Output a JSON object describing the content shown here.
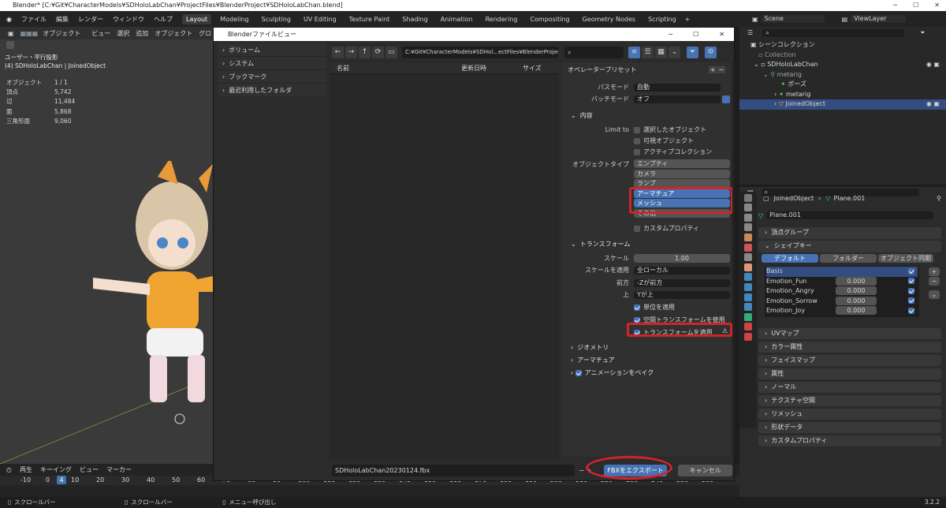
{
  "window": {
    "title": "Blender* [C:¥Git¥CharacterModels¥SDHoloLabChan¥ProjectFiles¥BlenderProject¥SDHoloLabChan.blend]"
  },
  "menu": [
    "ファイル",
    "編集",
    "レンダー",
    "ウィンドウ",
    "ヘルプ"
  ],
  "workspaces": [
    "Layout",
    "Modeling",
    "Sculpting",
    "UV Editing",
    "Texture Paint",
    "Shading",
    "Animation",
    "Rendering",
    "Compositing",
    "Geometry Nodes",
    "Scripting"
  ],
  "active_workspace": "Layout",
  "scene": {
    "label": "Scene",
    "view_layer": "ViewLayer"
  },
  "viewport": {
    "mode": "オブジェクト",
    "header_menus": [
      "ビュー",
      "選択",
      "追加",
      "オブジェクト"
    ],
    "gl_label": "グロ",
    "view_name": "ユーザー・平行投影",
    "object_name": "(4) SDHoloLabChan | JoinedObject",
    "stats": [
      {
        "label": "オブジェクト",
        "value": "1 / 1"
      },
      {
        "label": "頂点",
        "value": "5,742"
      },
      {
        "label": "辺",
        "value": "11,484"
      },
      {
        "label": "面",
        "value": "5,868"
      },
      {
        "label": "三角形面",
        "value": "9,060"
      }
    ]
  },
  "dialog": {
    "title": "Blenderファイルビュー",
    "sidebar": [
      "ボリューム",
      "システム",
      "ブックマーク",
      "最近利用したフォルダ"
    ],
    "path": "C:¥Git¥CharacterModels¥SDHol...ectFiles¥BlenderProject¥Export¥",
    "columns": {
      "name": "名前",
      "date": "更新日時",
      "size": "サイズ"
    },
    "operator_preset": "オペレータープリセット",
    "path_mode": {
      "label": "パスモード",
      "value": "自動"
    },
    "batch_mode": {
      "label": "バッチモード",
      "value": "オフ"
    },
    "include_section": "内容",
    "limit_to": {
      "label": "Limit to",
      "options": [
        {
          "label": "選択したオブジェクト",
          "checked": false
        },
        {
          "label": "可視オブジェクト",
          "checked": false
        },
        {
          "label": "アクティブコレクション",
          "checked": false
        }
      ]
    },
    "object_type": {
      "label": "オブジェクトタイプ",
      "options": [
        {
          "label": "エンプティ",
          "selected": false
        },
        {
          "label": "カメラ",
          "selected": false
        },
        {
          "label": "ランプ",
          "selected": false
        },
        {
          "label": "アーマチュア",
          "selected": true
        },
        {
          "label": "メッシュ",
          "selected": true
        },
        {
          "label": "その他",
          "selected": false
        }
      ]
    },
    "custom_props": {
      "label": "カスタムプロパティ",
      "checked": false
    },
    "transform_section": "トランスフォーム",
    "scale": {
      "label": "スケール",
      "value": "1.00"
    },
    "apply_scaling": {
      "label": "スケールを適用",
      "value": "全ローカル"
    },
    "forward": {
      "label": "前方",
      "value": "-Zが前方"
    },
    "up": {
      "label": "上",
      "value": "Yが上"
    },
    "apply_unit": {
      "label": "単位を適用",
      "checked": true
    },
    "space_transform": {
      "label": "空間トランスフォームを使用",
      "checked": true
    },
    "apply_transform": {
      "label": "トランスフォームを適用",
      "checked": true
    },
    "collapsed_sections": [
      "ジオメトリ",
      "アーマチュア"
    ],
    "bake_anim": {
      "label": "アニメーションをベイク",
      "checked": true
    },
    "filename": "SDHoloLabChan20230124.fbx",
    "export_label": "FBXをエクスポート",
    "cancel_label": "キャンセル"
  },
  "outliner": {
    "root": "シーンコレクション",
    "items": [
      {
        "label": "Collection",
        "level": 1
      },
      {
        "label": "SDHoloLabChan",
        "level": 1
      },
      {
        "label": "metarig",
        "level": 2
      },
      {
        "label": "ポーズ",
        "level": 3
      },
      {
        "label": "metarig",
        "level": 3
      },
      {
        "label": "JoinedObject",
        "level": 2
      }
    ]
  },
  "properties": {
    "breadcrumb_object": "JoinedObject",
    "breadcrumb_data": "Plane.001",
    "mesh_name": "Plane.001",
    "sections_top": [
      "頂点グループ",
      "シェイプキー"
    ],
    "shapekey_tabs": [
      "デフォルト",
      "フォルダー",
      "オブジェクト同期"
    ],
    "shapekeys": [
      {
        "name": "Basis",
        "value": ""
      },
      {
        "name": "Emotion_Fun",
        "value": "0.000"
      },
      {
        "name": "Emotion_Angry",
        "value": "0.000"
      },
      {
        "name": "Emotion_Sorrow",
        "value": "0.000"
      },
      {
        "name": "Emotion_Joy",
        "value": "0.000"
      }
    ],
    "sections_bottom": [
      "UVマップ",
      "カラー属性",
      "フェイスマップ",
      "属性",
      "ノーマル",
      "テクスチャ空間",
      "リメッシュ",
      "形状データ",
      "カスタムプロパティ"
    ]
  },
  "timeline": {
    "menus": [
      "再生",
      "キーイング",
      "ビュー",
      "マーカー"
    ],
    "current_frame": "4",
    "ticks": [
      "-10",
      "0",
      "10",
      "20",
      "30",
      "40",
      "50",
      "60",
      "70",
      "80",
      "90",
      "100",
      "110",
      "120",
      "130",
      "140",
      "150",
      "160",
      "170",
      "180",
      "190",
      "200",
      "210",
      "220",
      "230",
      "240",
      "250",
      "260"
    ]
  },
  "statusbar": {
    "left": "スクロールバー",
    "mid": "スクロールバー",
    "right": "メニュー呼び出し",
    "version": "3.2.2"
  }
}
